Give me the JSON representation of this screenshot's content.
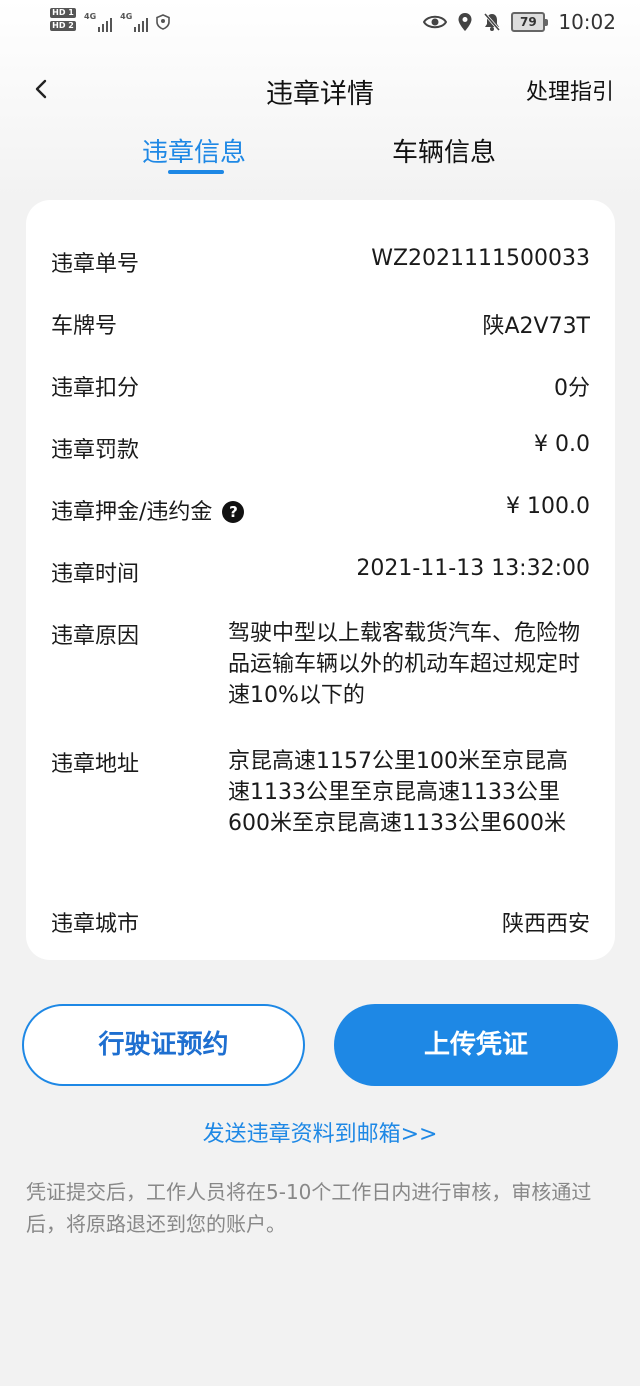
{
  "status_bar": {
    "hd1": "HD 1",
    "hd2": "HD 2",
    "sig1": "4G",
    "sig2": "4G",
    "battery": "79",
    "time": "10:02"
  },
  "header": {
    "back_icon": "back-chevron-icon",
    "title": "违章详情",
    "guide": "处理指引"
  },
  "tabs": [
    {
      "label": "违章信息",
      "active": true
    },
    {
      "label": "车辆信息",
      "active": false
    }
  ],
  "details": {
    "ticket_no": {
      "label": "违章单号",
      "value": "WZ2021111500033"
    },
    "plate": {
      "label": "车牌号",
      "value": "陕A2V73T"
    },
    "points": {
      "label": "违章扣分",
      "value": "0分"
    },
    "fine": {
      "label": "违章罚款",
      "value": "¥ 0.0"
    },
    "deposit": {
      "label": "违章押金/违约金",
      "value": "¥ 100.0",
      "help_icon": "?"
    },
    "time": {
      "label": "违章时间",
      "value": "2021-11-13 13:32:00"
    },
    "reason": {
      "label": "违章原因",
      "value": "驾驶中型以上载客载货汽车、危险物品运输车辆以外的机动车超过规定时速10%以下的"
    },
    "address": {
      "label": "违章地址",
      "value": "京昆高速1157公里100米至京昆高速1133公里至京昆高速1133公里600米至京昆高速1133公里600米"
    },
    "city": {
      "label": "违章城市",
      "value": "陕西西安"
    }
  },
  "actions": {
    "appointment": "行驶证预约",
    "upload": "上传凭证",
    "email": "发送违章资料到邮箱>>"
  },
  "note": "凭证提交后，工作人员将在5-10个工作日内进行审核，审核通过后，将原路退还到您的账户。",
  "colors": {
    "accent": "#1e88e5",
    "background": "#f2f2f2",
    "card": "#ffffff",
    "note_text": "#888888"
  }
}
